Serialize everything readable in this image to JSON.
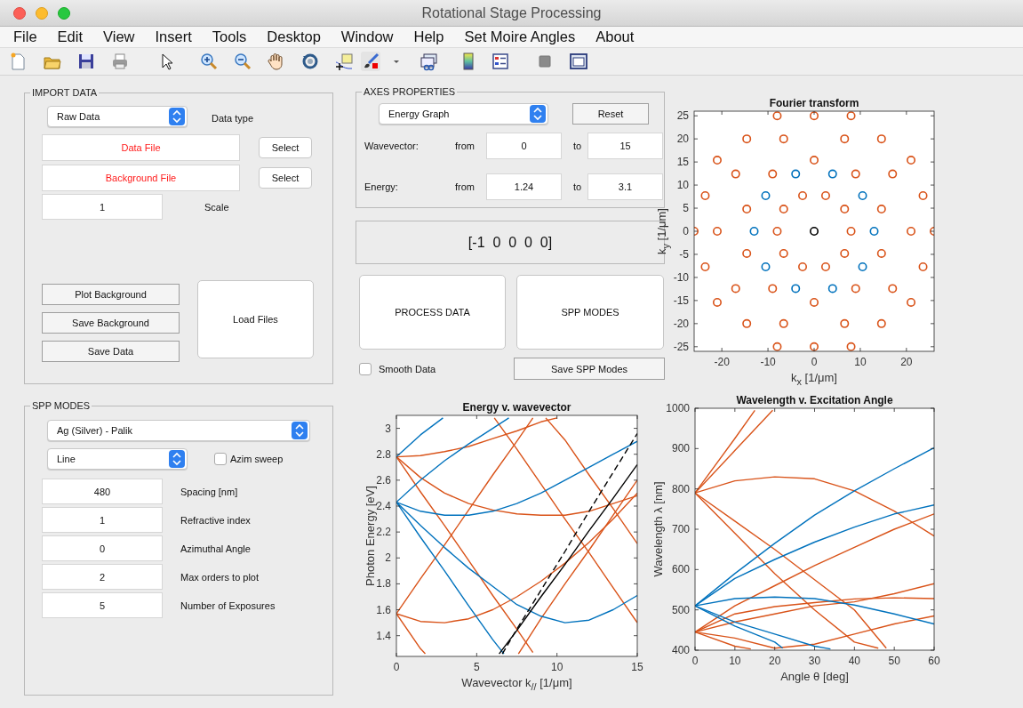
{
  "window": {
    "title": "Rotational Stage Processing"
  },
  "menu": [
    "File",
    "Edit",
    "View",
    "Insert",
    "Tools",
    "Desktop",
    "Window",
    "Help",
    "Set Moire Angles",
    "About"
  ],
  "import_data": {
    "title": "IMPORT DATA",
    "data_type": {
      "value": "Raw Data",
      "label": "Data type"
    },
    "files": [
      {
        "value": "Data File",
        "button": "Select"
      },
      {
        "value": "Background File",
        "button": "Select"
      }
    ],
    "scale": {
      "value": "1",
      "label": "Scale"
    },
    "buttons": [
      "Plot Background",
      "Save Background",
      "Save Data"
    ],
    "load_button": "Load Files"
  },
  "axes_properties": {
    "title": "AXES PROPERTIES",
    "graph": "Energy Graph",
    "reset_button": "Reset",
    "ranges": [
      {
        "label": "Wavevector:",
        "from_label": "from",
        "from": "0",
        "to_label": "to",
        "to": "15"
      },
      {
        "label": "Energy:",
        "from_label": "from",
        "from": "1.24",
        "to_label": "to",
        "to": "3.1"
      }
    ]
  },
  "display": "[-1  0  0  0  0]",
  "actions": {
    "process_button": "PROCESS DATA",
    "modes_button": "SPP MODES",
    "smooth": {
      "label": "Smooth Data",
      "checked": false
    },
    "save_modes_button": "Save SPP Modes"
  },
  "spp_modes": {
    "title": "SPP MODES",
    "material": "Ag (Silver) - Palik",
    "geometry": "Line",
    "azim_sweep": {
      "label": "Azim sweep",
      "checked": false
    },
    "fields": [
      {
        "value": "480",
        "label": "Spacing [nm]"
      },
      {
        "value": "1",
        "label": "Refractive index"
      },
      {
        "value": "0",
        "label": "Azimuthal Angle"
      },
      {
        "value": "2",
        "label": "Max orders to plot"
      },
      {
        "value": "5",
        "label": "Number of Exposures"
      }
    ]
  },
  "fourier_plot": {
    "chart_data": {
      "type": "scatter",
      "title": "Fourier transform",
      "xlabel": "k$_{x}$ [1/μm]",
      "ylabel": "k$_{y}$ [1/μm]",
      "xlim": [
        -26,
        26
      ],
      "ylim": [
        -26,
        26
      ],
      "xticks": [
        -20,
        -10,
        0,
        10,
        20
      ],
      "yticks": [
        -25,
        -20,
        -15,
        -10,
        -5,
        0,
        5,
        10,
        15,
        20,
        25
      ],
      "series": [
        {
          "color": "#d95319",
          "x": [
            -8,
            0,
            8,
            -14.6,
            -6.6,
            6.6,
            14.6,
            -21,
            0,
            21,
            -17,
            -9,
            9,
            17,
            -23.6,
            -2.5,
            2.5,
            23.6,
            -14.6,
            -6.6,
            6.6,
            14.6,
            -26,
            -21,
            -8,
            8,
            21,
            26,
            -14.6,
            -6.6,
            6.6,
            14.6,
            -23.6,
            -2.5,
            2.5,
            23.6,
            -17,
            -9,
            9,
            17,
            -21,
            0,
            21,
            -14.6,
            -6.6,
            6.6,
            14.6,
            -8,
            0,
            8
          ],
          "values": [
            25,
            25,
            25,
            20,
            20,
            20,
            20,
            15.4,
            15.4,
            15.4,
            12.4,
            12.4,
            12.4,
            12.4,
            7.7,
            7.7,
            7.7,
            7.7,
            4.8,
            4.8,
            4.8,
            4.8,
            0,
            0,
            0,
            0,
            0,
            0,
            -4.8,
            -4.8,
            -4.8,
            -4.8,
            -7.7,
            -7.7,
            -7.7,
            -7.7,
            -12.4,
            -12.4,
            -12.4,
            -12.4,
            -15.4,
            -15.4,
            -15.4,
            -20,
            -20,
            -20,
            -20,
            -25,
            -25,
            -25
          ]
        },
        {
          "color": "#0072bd",
          "x": [
            -4,
            4,
            -10.5,
            10.5,
            -13,
            13,
            -10.5,
            10.5,
            -4,
            4
          ],
          "values": [
            12.4,
            12.4,
            7.7,
            7.7,
            0,
            0,
            -7.7,
            -7.7,
            -12.4,
            -12.4
          ]
        },
        {
          "color": "#000000",
          "x": [
            0
          ],
          "values": [
            0
          ]
        }
      ]
    }
  },
  "energy_plot": {
    "chart_data": {
      "type": "line",
      "title": "Energy v. wavevector",
      "xlabel": "Wavevector k$_{//}$  [1/μm]",
      "ylabel": "Photon Energy  [eV]",
      "xlim": [
        0,
        15
      ],
      "ylim": [
        1.24,
        3.1
      ],
      "xticks": [
        0,
        5,
        10,
        15
      ],
      "yticks": [
        1.4,
        1.6,
        1.8,
        2,
        2.2,
        2.4,
        2.6,
        2.8,
        3
      ],
      "series": [
        {
          "color": "#d95319",
          "x": [
            0,
            1.5,
            3,
            4.5,
            6,
            7.5,
            9,
            10.5,
            12,
            13.5,
            15
          ],
          "values": [
            1.57,
            1.51,
            1.5,
            1.53,
            1.6,
            1.7,
            1.82,
            1.96,
            2.12,
            2.3,
            2.5
          ]
        },
        {
          "color": "#d95319",
          "x": [
            0,
            1.5,
            3,
            4.5,
            6,
            7.5,
            8.5
          ],
          "values": [
            1.57,
            1.84,
            2.1,
            2.37,
            2.64,
            2.9,
            3.08
          ]
        },
        {
          "color": "#d95319",
          "x": [
            0,
            1.5,
            3,
            4.5,
            6,
            7.5,
            8.5
          ],
          "values": [
            2.78,
            2.51,
            2.25,
            1.98,
            1.71,
            1.45,
            1.27
          ]
        },
        {
          "color": "#d95319",
          "x": [
            0,
            1.5,
            3,
            4.5,
            6,
            7.5,
            9,
            10.5,
            12,
            13.5,
            15
          ],
          "values": [
            2.78,
            2.62,
            2.5,
            2.42,
            2.37,
            2.34,
            2.33,
            2.33,
            2.36,
            2.42,
            2.48
          ]
        },
        {
          "color": "#d95319",
          "x": [
            0,
            1.5,
            3,
            4.5,
            6,
            7.5,
            9,
            10
          ],
          "values": [
            2.78,
            2.79,
            2.82,
            2.86,
            2.92,
            2.98,
            3.05,
            3.08
          ]
        },
        {
          "color": "#d95319",
          "x": [
            9.3,
            10.5,
            12,
            13.5,
            15
          ],
          "values": [
            3.08,
            2.91,
            2.64,
            2.38,
            2.11
          ]
        },
        {
          "color": "#d95319",
          "x": [
            6.1,
            7.5,
            9,
            10.5,
            12,
            13.5,
            15
          ],
          "values": [
            3.08,
            2.84,
            2.57,
            2.3,
            2.04,
            1.77,
            1.5
          ]
        },
        {
          "color": "#d95319",
          "x": [
            7.6,
            9,
            10.5,
            12,
            13.5,
            15
          ],
          "values": [
            1.26,
            1.53,
            1.8,
            2.06,
            2.33,
            2.6
          ]
        },
        {
          "color": "#d95319",
          "x": [
            0,
            1.5,
            1.8
          ],
          "values": [
            1.57,
            1.3,
            1.26
          ]
        },
        {
          "color": "#0072bd",
          "x": [
            0,
            1.5,
            3,
            4.5,
            6,
            6.7
          ],
          "values": [
            2.43,
            2.16,
            1.9,
            1.63,
            1.37,
            1.26
          ]
        },
        {
          "color": "#0072bd",
          "x": [
            0,
            1.5,
            3,
            4.5,
            6,
            7.5,
            9,
            10.5,
            12,
            13.5,
            15
          ],
          "values": [
            2.43,
            2.25,
            2.08,
            1.92,
            1.78,
            1.64,
            1.55,
            1.5,
            1.52,
            1.6,
            1.71
          ]
        },
        {
          "color": "#0072bd",
          "x": [
            0,
            1.5,
            3,
            4.5,
            6,
            7.5,
            9,
            10.5,
            12,
            13.5,
            15
          ],
          "values": [
            2.43,
            2.36,
            2.33,
            2.33,
            2.36,
            2.42,
            2.5,
            2.6,
            2.7,
            2.8,
            2.9
          ]
        },
        {
          "color": "#0072bd",
          "x": [
            0,
            1.5,
            3,
            4.5,
            6,
            7
          ],
          "values": [
            2.43,
            2.6,
            2.75,
            2.88,
            3.0,
            3.08
          ]
        },
        {
          "color": "#0072bd",
          "x": [
            0,
            1.5,
            2.9
          ],
          "values": [
            2.78,
            2.95,
            3.08
          ]
        },
        {
          "color": "#000000",
          "x": [
            6.4,
            7.5,
            9,
            10.5,
            12,
            13.5,
            15
          ],
          "values": [
            1.26,
            1.44,
            1.7,
            1.95,
            2.21,
            2.46,
            2.72
          ]
        },
        {
          "color": "#000000",
          "line_style": "dashed",
          "x": [
            6.6,
            7.5,
            9,
            10.5,
            12,
            13.5,
            15
          ],
          "values": [
            1.26,
            1.45,
            1.75,
            2.05,
            2.36,
            2.66,
            2.96
          ]
        }
      ]
    }
  },
  "wavelength_plot": {
    "chart_data": {
      "type": "line",
      "title": "Wavelength v. Excitation Angle",
      "xlabel": "Angle θ  [deg]",
      "ylabel": "Wavelength λ  [nm]",
      "xlim": [
        0,
        60
      ],
      "ylim": [
        400,
        1000
      ],
      "xticks": [
        0,
        10,
        20,
        30,
        40,
        50,
        60
      ],
      "yticks": [
        400,
        500,
        600,
        700,
        800,
        900,
        1000
      ],
      "series": [
        {
          "color": "#d95319",
          "x": [
            0,
            10,
            15
          ],
          "values": [
            790,
            925,
            995
          ]
        },
        {
          "color": "#d95319",
          "x": [
            0,
            10,
            19.5
          ],
          "values": [
            790,
            895,
            995
          ]
        },
        {
          "color": "#d95319",
          "x": [
            0,
            10,
            20,
            30,
            40,
            50,
            60
          ],
          "values": [
            790,
            820,
            830,
            825,
            795,
            745,
            683
          ]
        },
        {
          "color": "#d95319",
          "x": [
            0,
            10,
            20,
            30,
            40,
            48
          ],
          "values": [
            790,
            720,
            650,
            575,
            500,
            405
          ]
        },
        {
          "color": "#d95319",
          "x": [
            0,
            10,
            20,
            30,
            40,
            46
          ],
          "values": [
            790,
            690,
            590,
            500,
            420,
            405
          ]
        },
        {
          "color": "#d95319",
          "x": [
            0,
            10,
            20,
            30,
            40,
            50,
            60
          ],
          "values": [
            445,
            510,
            560,
            610,
            655,
            700,
            738
          ]
        },
        {
          "color": "#d95319",
          "x": [
            0,
            10,
            20,
            30,
            40,
            50,
            60
          ],
          "values": [
            445,
            490,
            508,
            518,
            527,
            530,
            528
          ]
        },
        {
          "color": "#d95319",
          "x": [
            0,
            10,
            20,
            30,
            40,
            50,
            60
          ],
          "values": [
            445,
            470,
            490,
            510,
            520,
            540,
            565
          ]
        },
        {
          "color": "#d95319",
          "x": [
            0,
            10,
            20,
            30,
            40,
            50,
            60
          ],
          "values": [
            445,
            430,
            405,
            415,
            440,
            465,
            485
          ]
        },
        {
          "color": "#d95319",
          "x": [
            0,
            10,
            14
          ],
          "values": [
            445,
            410,
            403
          ]
        },
        {
          "color": "#0072bd",
          "x": [
            0,
            10,
            20,
            30,
            40,
            50,
            60
          ],
          "values": [
            510,
            590,
            665,
            735,
            795,
            850,
            902
          ]
        },
        {
          "color": "#0072bd",
          "x": [
            0,
            10,
            20,
            30,
            40,
            50,
            60
          ],
          "values": [
            510,
            578,
            625,
            668,
            705,
            738,
            760
          ]
        },
        {
          "color": "#0072bd",
          "x": [
            0,
            10,
            20,
            30,
            40,
            50,
            60
          ],
          "values": [
            510,
            528,
            532,
            528,
            512,
            490,
            465
          ]
        },
        {
          "color": "#0072bd",
          "x": [
            0,
            10,
            20,
            22
          ],
          "values": [
            510,
            460,
            420,
            405
          ]
        },
        {
          "color": "#0072bd",
          "x": [
            0,
            10,
            20,
            30,
            34
          ],
          "values": [
            510,
            470,
            440,
            410,
            403
          ]
        }
      ]
    }
  }
}
